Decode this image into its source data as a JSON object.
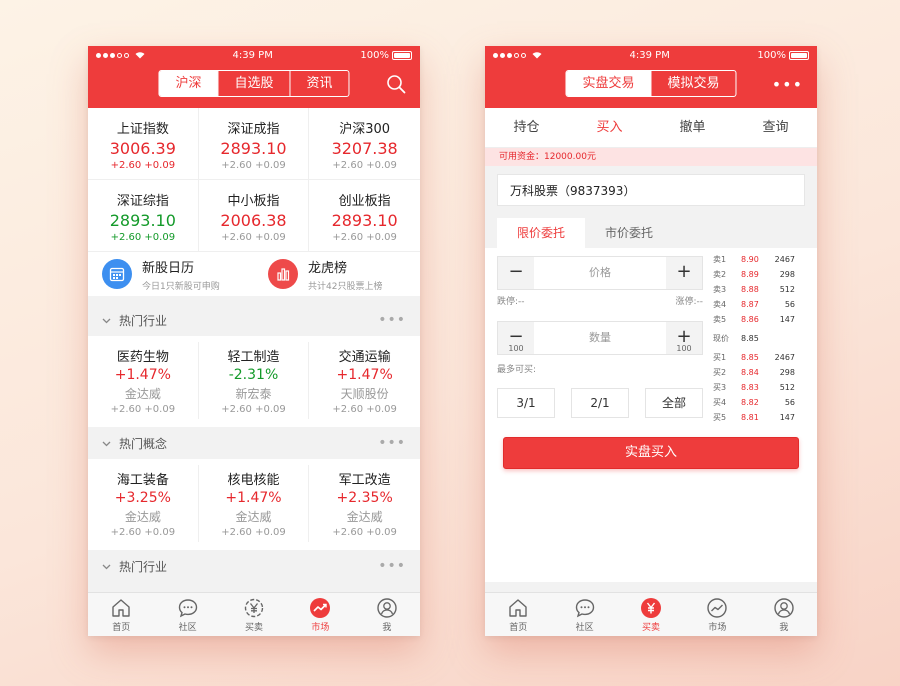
{
  "status": {
    "time": "4:39 PM",
    "battery": "100%"
  },
  "left": {
    "tabs": [
      {
        "label": "沪深",
        "active": true
      },
      {
        "label": "自选股",
        "active": false
      },
      {
        "label": "资讯",
        "active": false
      }
    ],
    "indices": [
      {
        "name": "上证指数",
        "value": "3006.39",
        "change": "+2.60 +0.09",
        "color": "red"
      },
      {
        "name": "深证成指",
        "value": "2893.10",
        "change": "+2.60 +0.09",
        "color": "red"
      },
      {
        "name": "沪深300",
        "value": "3207.38",
        "change": "+2.60 +0.09",
        "color": "red"
      },
      {
        "name": "深证综指",
        "value": "2893.10",
        "change": "+2.60 +0.09",
        "color": "green"
      },
      {
        "name": "中小板指",
        "value": "2006.38",
        "change": "+2.60 +0.09",
        "color": "red"
      },
      {
        "name": "创业板指",
        "value": "2893.10",
        "change": "+2.60 +0.09",
        "color": "red"
      }
    ],
    "shortcuts": [
      {
        "title": "新股日历",
        "sub": "今日1只新股可申购",
        "color": "#3d8ff0"
      },
      {
        "title": "龙虎榜",
        "sub": "共计42只股票上榜",
        "color": "#ee4a4a"
      }
    ],
    "sections": [
      {
        "title": "热门行业",
        "items": [
          {
            "name": "医药生物",
            "pct": "+1.47%",
            "color": "red",
            "stock": "金达威",
            "change": "+2.60 +0.09"
          },
          {
            "name": "轻工制造",
            "pct": "-2.31%",
            "color": "green",
            "stock": "新宏泰",
            "change": "+2.60 +0.09"
          },
          {
            "name": "交通运输",
            "pct": "+1.47%",
            "color": "red",
            "stock": "天顺股份",
            "change": "+2.60 +0.09"
          }
        ]
      },
      {
        "title": "热门概念",
        "items": [
          {
            "name": "海工装备",
            "pct": "+3.25%",
            "color": "red",
            "stock": "金达威",
            "change": "+2.60 +0.09"
          },
          {
            "name": "核电核能",
            "pct": "+1.47%",
            "color": "red",
            "stock": "金达威",
            "change": "+2.60 +0.09"
          },
          {
            "name": "军工改造",
            "pct": "+2.35%",
            "color": "red",
            "stock": "金达威",
            "change": "+2.60 +0.09"
          }
        ]
      },
      {
        "title": "热门行业",
        "items": []
      }
    ],
    "tabbar": [
      {
        "label": "首页",
        "icon": "home-icon",
        "active": false
      },
      {
        "label": "社区",
        "icon": "chat-icon",
        "active": false
      },
      {
        "label": "买卖",
        "icon": "yen-icon",
        "active": false
      },
      {
        "label": "市场",
        "icon": "trend-icon",
        "active": true
      },
      {
        "label": "我",
        "icon": "user-icon",
        "active": false
      }
    ]
  },
  "right": {
    "tabs": [
      {
        "label": "实盘交易",
        "active": true
      },
      {
        "label": "模拟交易",
        "active": false
      }
    ],
    "more_label": "•••",
    "trade_tabs": [
      {
        "label": "持仓",
        "active": false
      },
      {
        "label": "买入",
        "active": true
      },
      {
        "label": "撤单",
        "active": false
      },
      {
        "label": "查询",
        "active": false
      }
    ],
    "funds": "可用资金：12000.00元",
    "stock": "万科股票（9837393）",
    "order_tabs": [
      {
        "label": "限价委托",
        "active": true
      },
      {
        "label": "市价委托",
        "active": false
      }
    ],
    "price": {
      "minus": "−",
      "label": "价格",
      "plus": "+"
    },
    "limit_down": "跌停:--",
    "limit_up": "涨停:--",
    "quantity": {
      "minus": "−",
      "label": "数量",
      "plus": "+",
      "minus_sub": "100",
      "plus_sub": "100"
    },
    "max_buy": "最多可买:",
    "ratios": [
      "3/1",
      "2/1",
      "全部"
    ],
    "buy_button": "实盘买入",
    "asks": [
      {
        "label": "卖1",
        "price": "8.90",
        "vol": "2467"
      },
      {
        "label": "卖2",
        "price": "8.89",
        "vol": "298"
      },
      {
        "label": "卖3",
        "price": "8.88",
        "vol": "512"
      },
      {
        "label": "卖4",
        "price": "8.87",
        "vol": "56"
      },
      {
        "label": "卖5",
        "price": "8.86",
        "vol": "147"
      }
    ],
    "current": {
      "label": "现价",
      "price": "8.85"
    },
    "bids": [
      {
        "label": "买1",
        "price": "8.85",
        "vol": "2467"
      },
      {
        "label": "买2",
        "price": "8.84",
        "vol": "298"
      },
      {
        "label": "买3",
        "price": "8.83",
        "vol": "512"
      },
      {
        "label": "买4",
        "price": "8.82",
        "vol": "56"
      },
      {
        "label": "买5",
        "price": "8.81",
        "vol": "147"
      }
    ],
    "tabbar": [
      {
        "label": "首页",
        "icon": "home-icon",
        "active": false
      },
      {
        "label": "社区",
        "icon": "chat-icon",
        "active": false
      },
      {
        "label": "买卖",
        "icon": "yen-icon",
        "active": true
      },
      {
        "label": "市场",
        "icon": "trend-icon",
        "active": false
      },
      {
        "label": "我",
        "icon": "user-icon",
        "active": false
      }
    ]
  },
  "colors": {
    "brand": "#ee3c3c",
    "up": "#e6282d",
    "down": "#149a2a"
  }
}
